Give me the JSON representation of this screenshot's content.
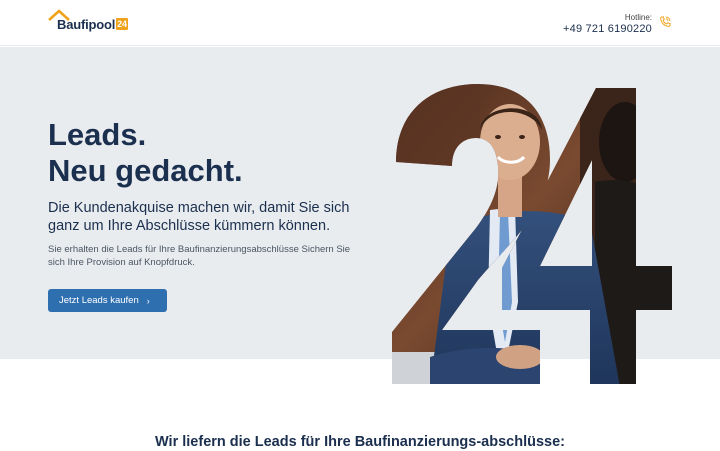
{
  "header": {
    "logo_text": "Baufipool",
    "logo_badge": "24",
    "hotline_label": "Hotline:",
    "hotline_number": "+49 721 6190220"
  },
  "hero": {
    "headline_line1": "Leads.",
    "headline_line2": "Neu gedacht.",
    "subline": "Die Kundenakquise machen wir, damit Sie sich ganz um Ihre Abschlüsse kümmern können.",
    "body": "Sie erhalten die Leads für Ihre Baufinanzierungsabschlüsse Sichern Sie sich Ihre Provision auf Knopfdruck.",
    "cta_label": "Jetzt Leads kaufen",
    "cta_icon": "chevron-right-icon",
    "visual_number": "24"
  },
  "section": {
    "heading_part1": "Wir liefern die ",
    "heading_bold1": "Leads",
    "heading_part2": " für Ihre ",
    "heading_bold2": "Baufinanzierungs-abschlüsse:"
  },
  "colors": {
    "brand_navy": "#1b2f4e",
    "brand_orange": "#f0a21b",
    "button_blue": "#2e6fb0",
    "hero_background": "#e9ecef"
  }
}
